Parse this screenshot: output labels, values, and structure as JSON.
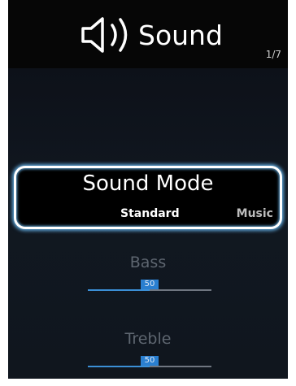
{
  "header": {
    "title": "Sound",
    "icon": "speaker-icon",
    "page_indicator": "1/7"
  },
  "sound_mode": {
    "label": "Sound Mode",
    "value": "Standard",
    "next_option": "Music"
  },
  "settings": [
    {
      "label": "Bass",
      "value": "50",
      "level": 50,
      "max": 100
    },
    {
      "label": "Treble",
      "value": "50",
      "level": 50,
      "max": 100
    }
  ],
  "colors": {
    "highlight_border": "#ffffff",
    "highlight_glow": "#5ea6d8",
    "slider_fill": "#3b8fd6",
    "slider_value_bg": "#2a7fd0"
  }
}
